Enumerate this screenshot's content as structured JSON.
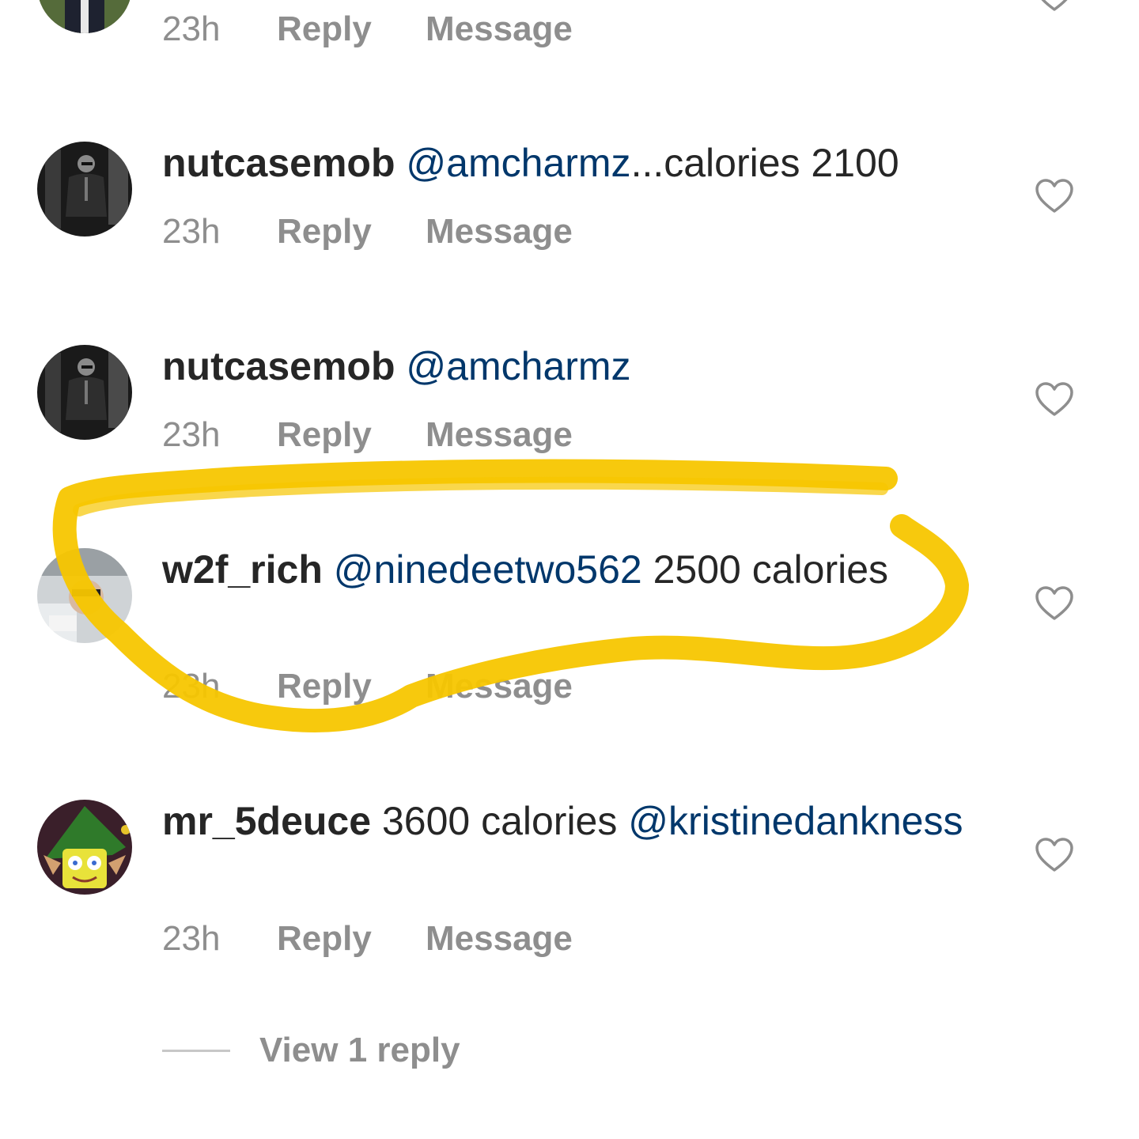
{
  "comments": [
    {
      "username": "",
      "mention": "",
      "text": "",
      "time": "23h",
      "reply_label": "Reply",
      "message_label": "Message"
    },
    {
      "username": "nutcasemob",
      "mention": "@amcharmz",
      "text": "...calories 2100",
      "time": "23h",
      "reply_label": "Reply",
      "message_label": "Message"
    },
    {
      "username": "nutcasemob",
      "mention": "@amcharmz",
      "text": "",
      "time": "23h",
      "reply_label": "Reply",
      "message_label": "Message"
    },
    {
      "username": "w2f_rich",
      "mention": "@ninedeetwo562",
      "text": " 2500 calories",
      "time": "23h",
      "reply_label": "Reply",
      "message_label": "Message"
    },
    {
      "username": "mr_5deuce",
      "text": "3600 calories",
      "mention": "@kristinedankness",
      "time": "23h",
      "reply_label": "Reply",
      "message_label": "Message"
    }
  ],
  "view_replies_label": "View 1 reply",
  "colors": {
    "highlight": "#f7c600",
    "mention": "#00376b",
    "meta": "#8e8e8e",
    "text": "#262626"
  },
  "icons": {
    "like": "heart-outline-icon"
  }
}
